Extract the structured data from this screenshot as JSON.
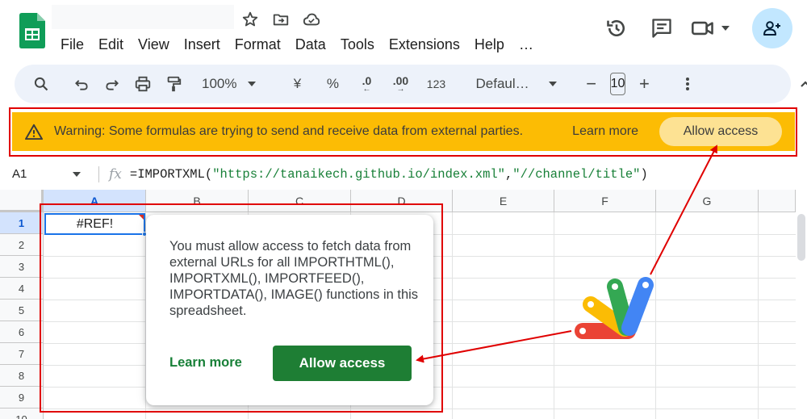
{
  "header": {
    "menu": [
      "File",
      "Edit",
      "View",
      "Insert",
      "Format",
      "Data",
      "Tools",
      "Extensions",
      "Help"
    ],
    "menu_more": "…"
  },
  "toolbar": {
    "zoom": "100%",
    "currency": "¥",
    "percent": "%",
    "dec_decrease": ".0",
    "dec_increase": ".00",
    "number_format": "123",
    "font_family": "Defaul…",
    "font_size": "10",
    "minus": "−",
    "plus": "+"
  },
  "banner": {
    "text": "Warning: Some formulas are trying to send and receive data from external parties.",
    "learn_more": "Learn more",
    "allow_access": "Allow access",
    "background": "#fcbc04"
  },
  "formula_bar": {
    "cell_ref": "A1",
    "fx": "fx",
    "formula_prefix": "=IMPORTXML(",
    "arg1": "\"https://tanaikech.github.io/index.xml\"",
    "comma": ",",
    "arg2": "\"//channel/title\"",
    "formula_suffix": ")"
  },
  "grid": {
    "columns": [
      "A",
      "B",
      "C",
      "D",
      "E",
      "F",
      "G"
    ],
    "rows": [
      "1",
      "2",
      "3",
      "4",
      "5",
      "6",
      "7",
      "8",
      "9",
      "10"
    ],
    "a1_value": "#REF!"
  },
  "popup": {
    "message": "You must allow access to fetch data from external URLs for all IMPORTHTML(), IMPORTXML(), IMPORTFEED(), IMPORTDATA(), IMAGE() functions in this spreadsheet.",
    "learn_more": "Learn more",
    "allow_access": "Allow access",
    "button_color": "#1e7e34"
  },
  "annotation": {
    "highlight_color": "#e00000"
  }
}
